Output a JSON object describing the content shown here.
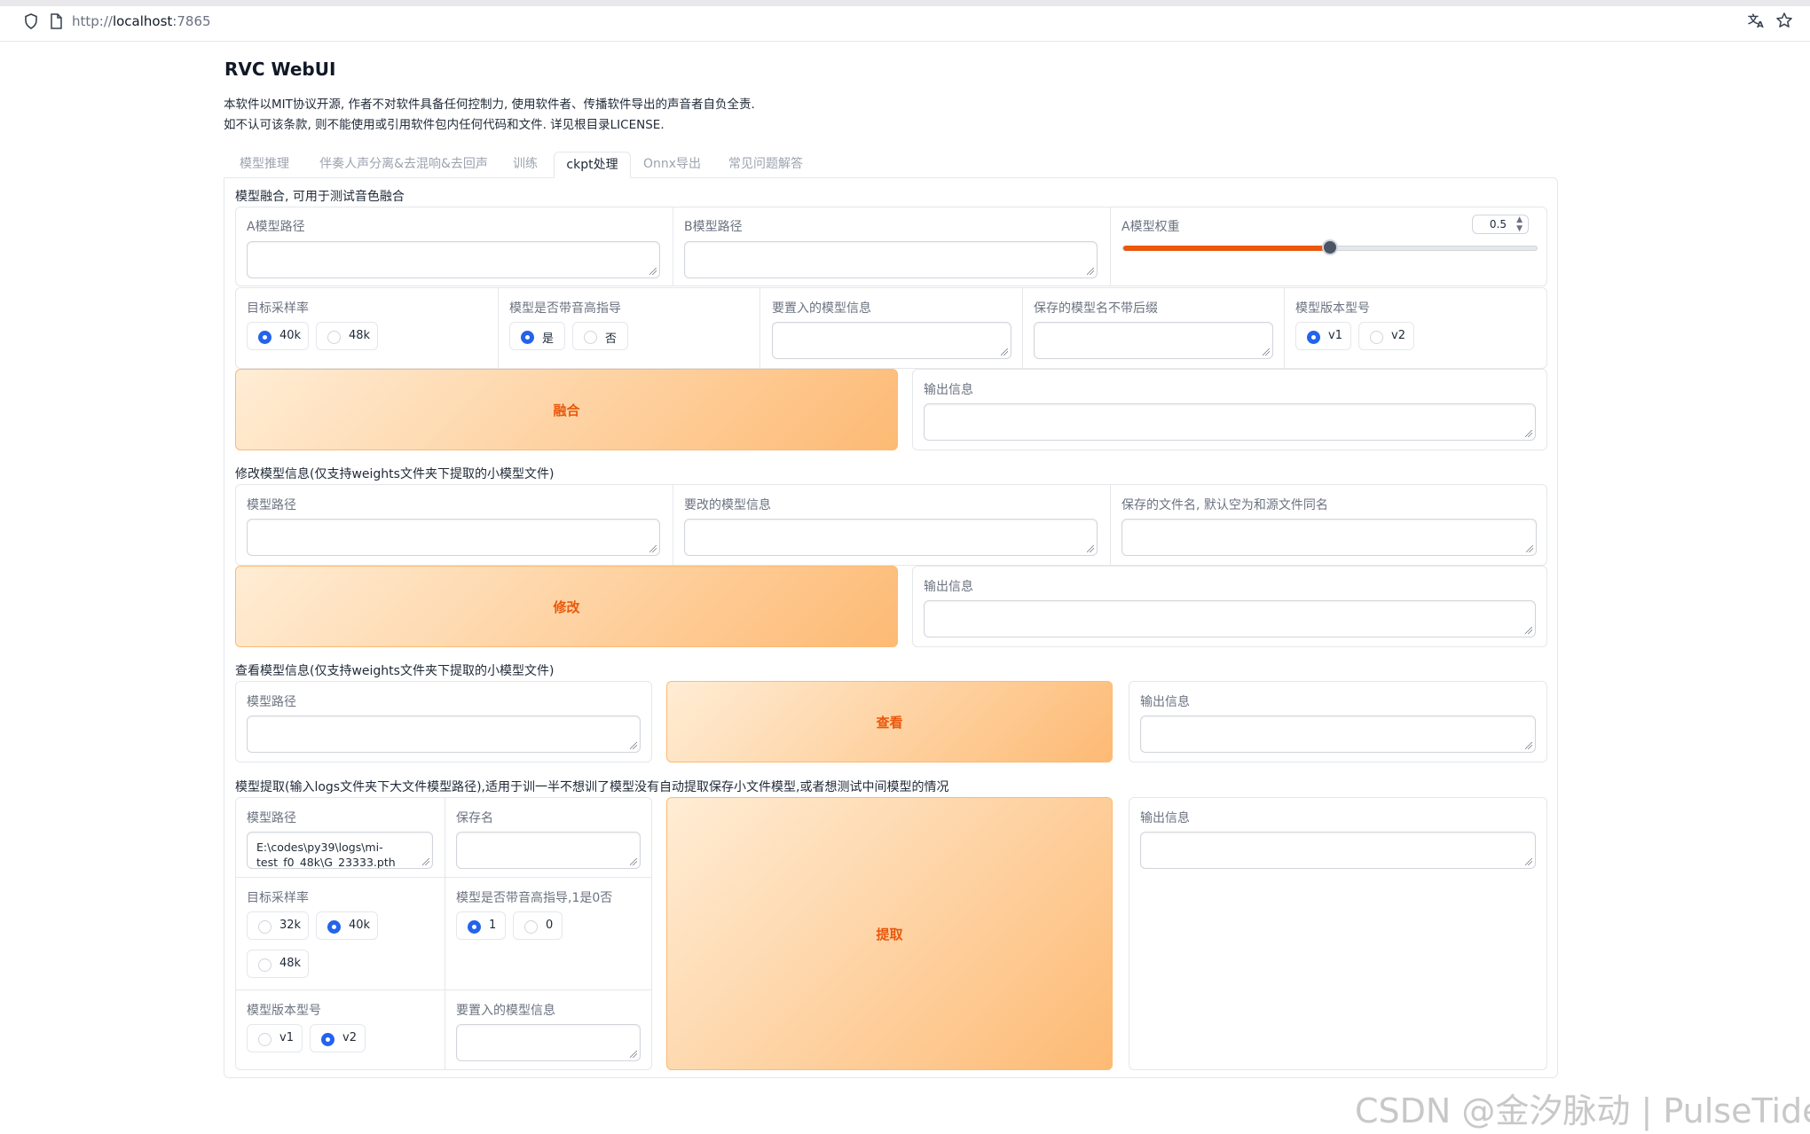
{
  "browser": {
    "url_scheme": "http://",
    "url_host": "localhost",
    "url_port": ":7865",
    "icons": [
      "shield-icon",
      "page-icon",
      "translate-icon",
      "star-icon"
    ]
  },
  "app": {
    "title": "RVC WebUI",
    "desc_line1": "本软件以MIT协议开源, 作者不对软件具备任何控制力, 使用软件者、传播软件导出的声音者自负全责.",
    "desc_line2": "如不认可该条款, 则不能使用或引用软件包内任何代码和文件. 详见根目录LICENSE."
  },
  "tabs": [
    {
      "label": "模型推理",
      "active": false
    },
    {
      "label": "伴奏人声分离&去混响&去回声",
      "active": false
    },
    {
      "label": "训练",
      "active": false
    },
    {
      "label": "ckpt处理",
      "active": true
    },
    {
      "label": "Onnx导出",
      "active": false
    },
    {
      "label": "常见问题解答",
      "active": false
    }
  ],
  "merge": {
    "section_title": "模型融合, 可用于测试音色融合",
    "model_a_label": "A模型路径",
    "model_b_label": "B模型路径",
    "weight_label": "A模型权重",
    "weight_value": "0.5",
    "weight_fraction": 0.5,
    "sr_label": "目标采样率",
    "sr_options": [
      "40k",
      "48k"
    ],
    "sr_selected": "40k",
    "f0_label": "模型是否带音高指导",
    "f0_options": [
      "是",
      "否"
    ],
    "f0_selected": "是",
    "info_label": "要置入的模型信息",
    "name_label": "保存的模型名不带后缀",
    "version_label": "模型版本型号",
    "version_options": [
      "v1",
      "v2"
    ],
    "version_selected": "v1",
    "button": "融合",
    "output_label": "输出信息"
  },
  "modify": {
    "section_title": "修改模型信息(仅支持weights文件夹下提取的小模型文件)",
    "path_label": "模型路径",
    "info_label": "要改的模型信息",
    "save_label": "保存的文件名, 默认空为和源文件同名",
    "button": "修改",
    "output_label": "输出信息"
  },
  "view": {
    "section_title": "查看模型信息(仅支持weights文件夹下提取的小模型文件)",
    "path_label": "模型路径",
    "button": "查看",
    "output_label": "输出信息"
  },
  "extract": {
    "section_title": "模型提取(输入logs文件夹下大文件模型路径),适用于训一半不想训了模型没有自动提取保存小文件模型,或者想测试中间模型的情况",
    "path_label": "模型路径",
    "path_value_line1": "E:\\codes\\py39\\logs\\mi-",
    "path_value_line2": "test_f0_48k\\G_23333.pth",
    "save_name_label": "保存名",
    "sr_label": "目标采样率",
    "sr_options": [
      "32k",
      "40k",
      "48k"
    ],
    "sr_selected": "40k",
    "f0_label": "模型是否带音高指导,1是0否",
    "f0_options": [
      "1",
      "0"
    ],
    "f0_selected": "1",
    "version_label": "模型版本型号",
    "version_options": [
      "v1",
      "v2"
    ],
    "version_selected": "v2",
    "info_label": "要置入的模型信息",
    "button": "提取",
    "output_label": "输出信息"
  },
  "watermark": "CSDN @金汐脉动 | PulseTide",
  "colors": {
    "accent_orange": "#ea580c",
    "button_gradient_start": "#ffedd5",
    "button_gradient_end": "#fdba74",
    "radio_selected": "#2563eb",
    "slider_fill": "#ea580c"
  }
}
